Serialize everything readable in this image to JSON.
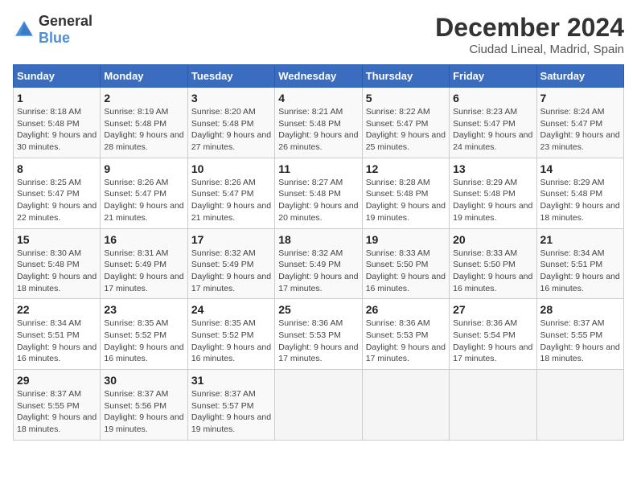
{
  "logo": {
    "general": "General",
    "blue": "Blue"
  },
  "title": {
    "month": "December 2024",
    "location": "Ciudad Lineal, Madrid, Spain"
  },
  "weekdays": [
    "Sunday",
    "Monday",
    "Tuesday",
    "Wednesday",
    "Thursday",
    "Friday",
    "Saturday"
  ],
  "weeks": [
    [
      {
        "day": "1",
        "sunrise": "Sunrise: 8:18 AM",
        "sunset": "Sunset: 5:48 PM",
        "daylight": "Daylight: 9 hours and 30 minutes."
      },
      {
        "day": "2",
        "sunrise": "Sunrise: 8:19 AM",
        "sunset": "Sunset: 5:48 PM",
        "daylight": "Daylight: 9 hours and 28 minutes."
      },
      {
        "day": "3",
        "sunrise": "Sunrise: 8:20 AM",
        "sunset": "Sunset: 5:48 PM",
        "daylight": "Daylight: 9 hours and 27 minutes."
      },
      {
        "day": "4",
        "sunrise": "Sunrise: 8:21 AM",
        "sunset": "Sunset: 5:48 PM",
        "daylight": "Daylight: 9 hours and 26 minutes."
      },
      {
        "day": "5",
        "sunrise": "Sunrise: 8:22 AM",
        "sunset": "Sunset: 5:47 PM",
        "daylight": "Daylight: 9 hours and 25 minutes."
      },
      {
        "day": "6",
        "sunrise": "Sunrise: 8:23 AM",
        "sunset": "Sunset: 5:47 PM",
        "daylight": "Daylight: 9 hours and 24 minutes."
      },
      {
        "day": "7",
        "sunrise": "Sunrise: 8:24 AM",
        "sunset": "Sunset: 5:47 PM",
        "daylight": "Daylight: 9 hours and 23 minutes."
      }
    ],
    [
      {
        "day": "8",
        "sunrise": "Sunrise: 8:25 AM",
        "sunset": "Sunset: 5:47 PM",
        "daylight": "Daylight: 9 hours and 22 minutes."
      },
      {
        "day": "9",
        "sunrise": "Sunrise: 8:26 AM",
        "sunset": "Sunset: 5:47 PM",
        "daylight": "Daylight: 9 hours and 21 minutes."
      },
      {
        "day": "10",
        "sunrise": "Sunrise: 8:26 AM",
        "sunset": "Sunset: 5:47 PM",
        "daylight": "Daylight: 9 hours and 21 minutes."
      },
      {
        "day": "11",
        "sunrise": "Sunrise: 8:27 AM",
        "sunset": "Sunset: 5:48 PM",
        "daylight": "Daylight: 9 hours and 20 minutes."
      },
      {
        "day": "12",
        "sunrise": "Sunrise: 8:28 AM",
        "sunset": "Sunset: 5:48 PM",
        "daylight": "Daylight: 9 hours and 19 minutes."
      },
      {
        "day": "13",
        "sunrise": "Sunrise: 8:29 AM",
        "sunset": "Sunset: 5:48 PM",
        "daylight": "Daylight: 9 hours and 19 minutes."
      },
      {
        "day": "14",
        "sunrise": "Sunrise: 8:29 AM",
        "sunset": "Sunset: 5:48 PM",
        "daylight": "Daylight: 9 hours and 18 minutes."
      }
    ],
    [
      {
        "day": "15",
        "sunrise": "Sunrise: 8:30 AM",
        "sunset": "Sunset: 5:48 PM",
        "daylight": "Daylight: 9 hours and 18 minutes."
      },
      {
        "day": "16",
        "sunrise": "Sunrise: 8:31 AM",
        "sunset": "Sunset: 5:49 PM",
        "daylight": "Daylight: 9 hours and 17 minutes."
      },
      {
        "day": "17",
        "sunrise": "Sunrise: 8:32 AM",
        "sunset": "Sunset: 5:49 PM",
        "daylight": "Daylight: 9 hours and 17 minutes."
      },
      {
        "day": "18",
        "sunrise": "Sunrise: 8:32 AM",
        "sunset": "Sunset: 5:49 PM",
        "daylight": "Daylight: 9 hours and 17 minutes."
      },
      {
        "day": "19",
        "sunrise": "Sunrise: 8:33 AM",
        "sunset": "Sunset: 5:50 PM",
        "daylight": "Daylight: 9 hours and 16 minutes."
      },
      {
        "day": "20",
        "sunrise": "Sunrise: 8:33 AM",
        "sunset": "Sunset: 5:50 PM",
        "daylight": "Daylight: 9 hours and 16 minutes."
      },
      {
        "day": "21",
        "sunrise": "Sunrise: 8:34 AM",
        "sunset": "Sunset: 5:51 PM",
        "daylight": "Daylight: 9 hours and 16 minutes."
      }
    ],
    [
      {
        "day": "22",
        "sunrise": "Sunrise: 8:34 AM",
        "sunset": "Sunset: 5:51 PM",
        "daylight": "Daylight: 9 hours and 16 minutes."
      },
      {
        "day": "23",
        "sunrise": "Sunrise: 8:35 AM",
        "sunset": "Sunset: 5:52 PM",
        "daylight": "Daylight: 9 hours and 16 minutes."
      },
      {
        "day": "24",
        "sunrise": "Sunrise: 8:35 AM",
        "sunset": "Sunset: 5:52 PM",
        "daylight": "Daylight: 9 hours and 16 minutes."
      },
      {
        "day": "25",
        "sunrise": "Sunrise: 8:36 AM",
        "sunset": "Sunset: 5:53 PM",
        "daylight": "Daylight: 9 hours and 17 minutes."
      },
      {
        "day": "26",
        "sunrise": "Sunrise: 8:36 AM",
        "sunset": "Sunset: 5:53 PM",
        "daylight": "Daylight: 9 hours and 17 minutes."
      },
      {
        "day": "27",
        "sunrise": "Sunrise: 8:36 AM",
        "sunset": "Sunset: 5:54 PM",
        "daylight": "Daylight: 9 hours and 17 minutes."
      },
      {
        "day": "28",
        "sunrise": "Sunrise: 8:37 AM",
        "sunset": "Sunset: 5:55 PM",
        "daylight": "Daylight: 9 hours and 18 minutes."
      }
    ],
    [
      {
        "day": "29",
        "sunrise": "Sunrise: 8:37 AM",
        "sunset": "Sunset: 5:55 PM",
        "daylight": "Daylight: 9 hours and 18 minutes."
      },
      {
        "day": "30",
        "sunrise": "Sunrise: 8:37 AM",
        "sunset": "Sunset: 5:56 PM",
        "daylight": "Daylight: 9 hours and 19 minutes."
      },
      {
        "day": "31",
        "sunrise": "Sunrise: 8:37 AM",
        "sunset": "Sunset: 5:57 PM",
        "daylight": "Daylight: 9 hours and 19 minutes."
      },
      null,
      null,
      null,
      null
    ]
  ]
}
